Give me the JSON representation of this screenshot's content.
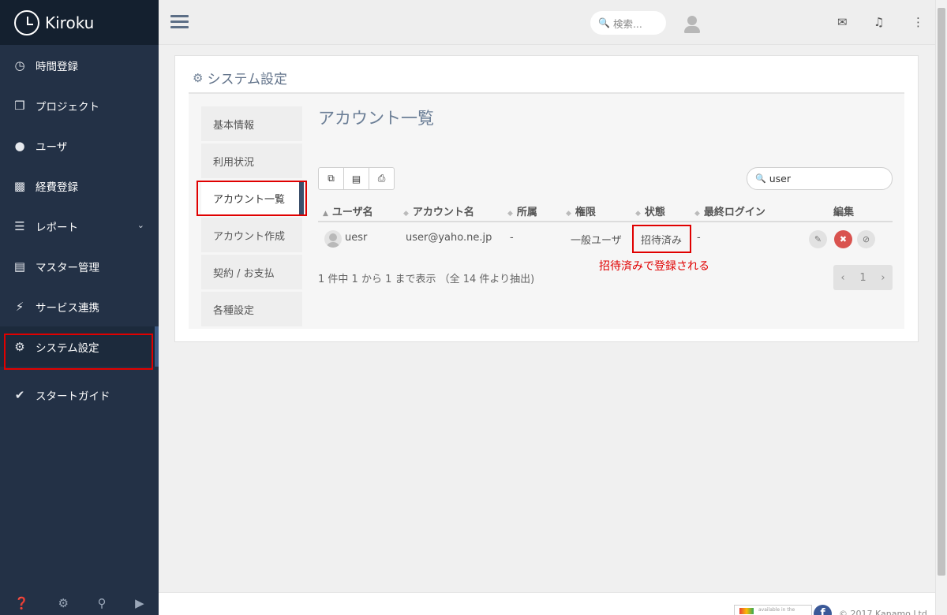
{
  "app": {
    "name": "Kiroku"
  },
  "sidebar": {
    "items": [
      {
        "label": "時間登録",
        "icon": "clock-icon"
      },
      {
        "label": "プロジェクト",
        "icon": "cubes-icon"
      },
      {
        "label": "ユーザ",
        "icon": "user-icon"
      },
      {
        "label": "経費登録",
        "icon": "train-icon"
      },
      {
        "label": "レポート",
        "icon": "list-icon"
      },
      {
        "label": "マスター管理",
        "icon": "database-icon"
      },
      {
        "label": "サービス連携",
        "icon": "plug-icon"
      },
      {
        "label": "システム設定",
        "icon": "gear-icon"
      },
      {
        "label": "スタートガイド",
        "icon": "check-icon"
      }
    ]
  },
  "topbar": {
    "search_placeholder": "検索..."
  },
  "page": {
    "title": "システム設定",
    "section_title": "アカウント一覧"
  },
  "subnav": {
    "items": [
      "基本情報",
      "利用状況",
      "アカウント一覧",
      "アカウント作成",
      "契約 / お支払",
      "各種設定"
    ]
  },
  "table": {
    "search_value": "user",
    "columns": [
      "ユーザ名",
      "アカウント名",
      "所属",
      "権限",
      "状態",
      "最終ログイン",
      "編集"
    ],
    "rows": [
      {
        "username": "uesr",
        "account": "user@yaho.ne.jp",
        "dept": "-",
        "role": "一般ユーザ",
        "status": "招待済み",
        "last_login": "-"
      }
    ],
    "info": "1 件中 1 から 1 まで表示 （全 14 件より抽出)",
    "page": "1"
  },
  "annotation": {
    "note": "招待済みで登録される"
  },
  "footer": {
    "store_badge": "available in the",
    "facebook": "f",
    "copyright": "© 2017 Kanamo Ltd."
  },
  "colors": {
    "sidebar": "#233146",
    "brand": "#14202f",
    "highlight": "#e00000",
    "delete": "#d9534f"
  }
}
